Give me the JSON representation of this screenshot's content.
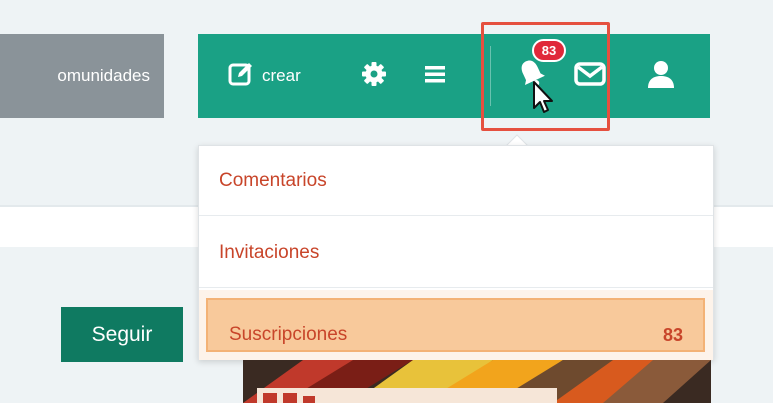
{
  "nav": {
    "communities_label": "omunidades"
  },
  "toolbar": {
    "create_label": "crear",
    "notifications_badge": "83",
    "icons": {
      "create": "edit-icon",
      "settings": "gear-icon",
      "menu": "hamburger-menu-icon",
      "notifications": "bell-icon",
      "mail": "mail-icon",
      "user": "user-icon"
    }
  },
  "dropdown": {
    "items": [
      {
        "label": "Comentarios"
      },
      {
        "label": "Invitaciones"
      },
      {
        "label": "Suscripciones",
        "count": "83",
        "highlighted": true
      }
    ]
  },
  "profile": {
    "follow_label": "Seguir"
  },
  "colors": {
    "toolbar_green": "#1aa185",
    "follow_green": "#0f7a61",
    "badge_red": "#e0283a",
    "link_orange": "#c8452a",
    "highlight_orange": "#f8c99b",
    "nav_grey": "#8a9399",
    "annotation_red": "#e5503f"
  }
}
